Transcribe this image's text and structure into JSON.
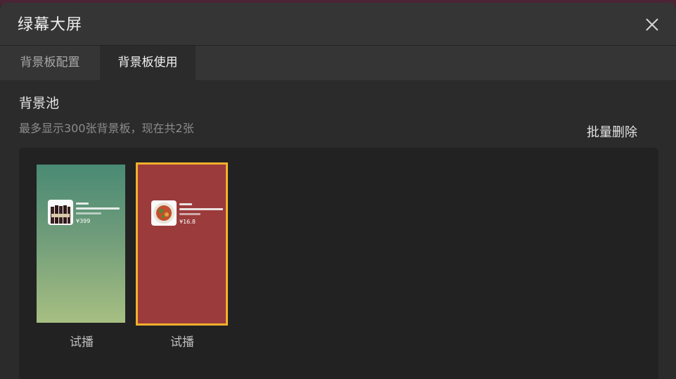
{
  "dialog": {
    "title": "绿幕大屏",
    "tabs": [
      {
        "label": "背景板配置",
        "active": false
      },
      {
        "label": "背景板使用",
        "active": true
      }
    ]
  },
  "pool": {
    "title": "背景池",
    "subtitle": "最多显示300张背景板，现在共2张",
    "bulk_delete_label": "批量删除",
    "cards": [
      {
        "price": "¥399",
        "trial_label": "试播",
        "bg_color": "#5f9478",
        "selected": false
      },
      {
        "price": "¥16.8",
        "trial_label": "试播",
        "bg_color": "#9b3b3b",
        "selected": true
      }
    ]
  },
  "colors": {
    "accent_selected": "#f2b02c",
    "dialog_bg": "#2b2b2b"
  },
  "icons": {
    "close": "close-icon"
  }
}
